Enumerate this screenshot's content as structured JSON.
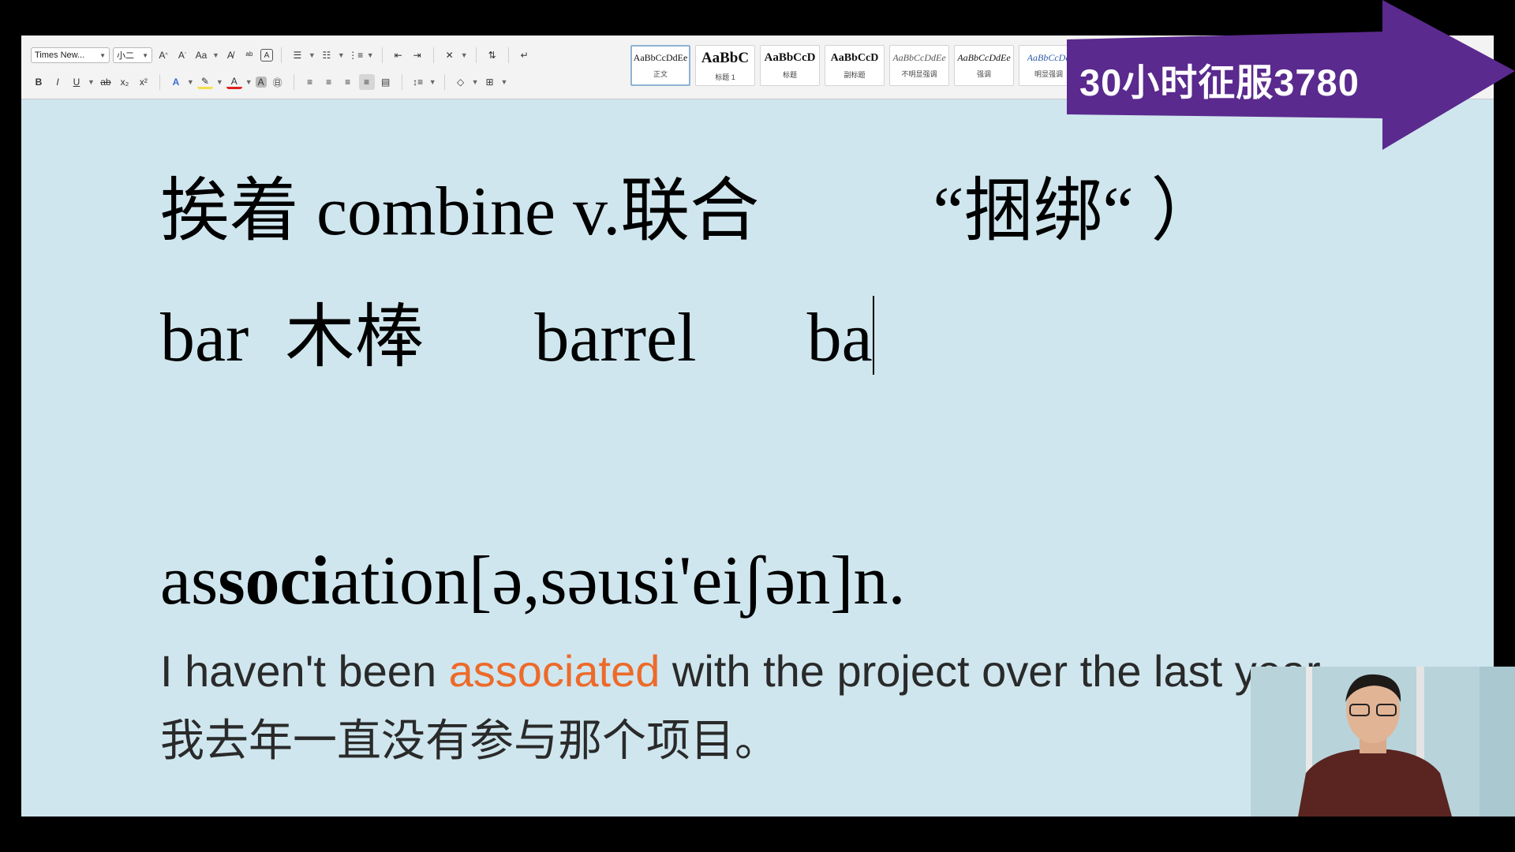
{
  "toolbar": {
    "font_name": "Times New...",
    "font_size": "小二",
    "styles": [
      {
        "preview": "AaBbCcDdEe",
        "label": "正文"
      },
      {
        "preview": "AaBbC",
        "label": "标题 1"
      },
      {
        "preview": "AaBbCcD",
        "label": "标题"
      },
      {
        "preview": "AaBbCcD",
        "label": "副标题"
      },
      {
        "preview": "AaBbCcDdEe",
        "label": "不明显强调"
      },
      {
        "preview": "AaBbCcDdEe",
        "label": "强调"
      },
      {
        "preview": "AaBbCcDd",
        "label": "明显强调"
      }
    ]
  },
  "document": {
    "line1": {
      "a": "挨着 combine v.联合",
      "b": "“捆绑“ ）"
    },
    "line2": {
      "a": "bar",
      "b": "木棒",
      "c": "barrel",
      "d": "ba"
    },
    "line3": {
      "word_pre": "as",
      "word_bold": "soci",
      "word_post": "ation",
      "ipa": "[ə,səusi'eiʃən]",
      "pos": "n."
    },
    "example_en": {
      "pre": "I haven't been ",
      "highlight": "associated",
      "post": " with the project over the last year."
    },
    "example_zh": "我去年一直没有参与那个项目。"
  },
  "banner": {
    "text": "30小时征服3780",
    "color": "#5a2a8e"
  },
  "colors": {
    "page": "#cfe6ee",
    "highlight": "#ed6a2a"
  }
}
